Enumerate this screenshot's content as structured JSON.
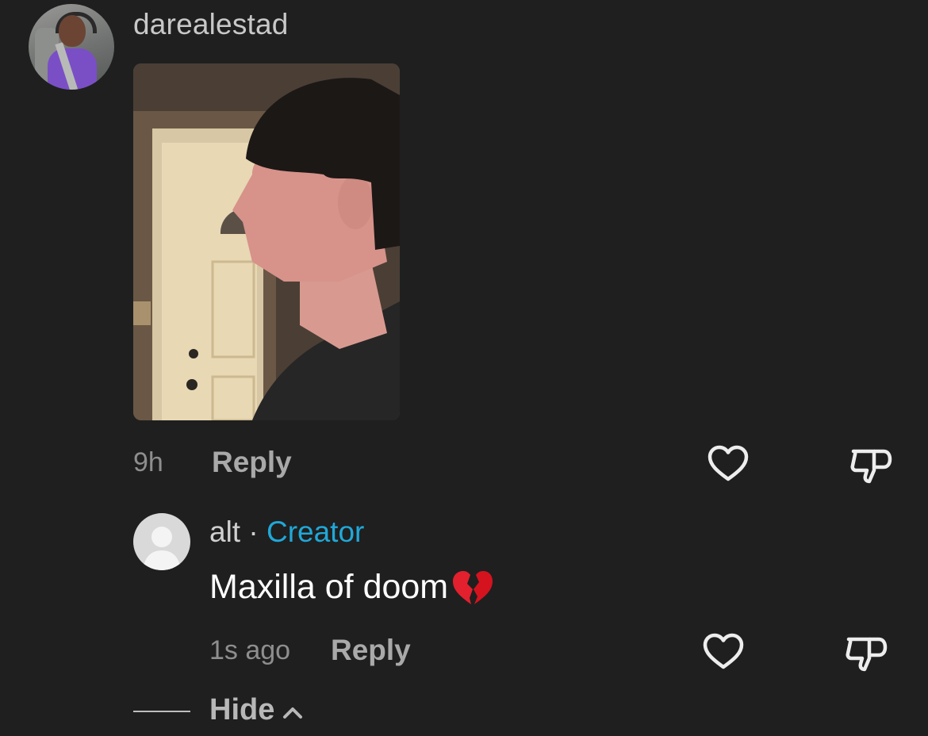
{
  "comment": {
    "username": "darealestad",
    "time": "9h",
    "reply_label": "Reply"
  },
  "reply_comment": {
    "username": "alt",
    "separator": "·",
    "badge": "Creator",
    "text": "Maxilla of doom",
    "emoji": "broken-heart",
    "time": "1s ago",
    "reply_label": "Reply"
  },
  "thread": {
    "hide_label": "Hide"
  },
  "icons": {
    "like": "heart-outline-icon",
    "dislike": "thumbs-down-icon",
    "collapse": "chevron-up-icon"
  },
  "colors": {
    "background": "#1f1f1f",
    "creator_badge": "#20a8d8",
    "muted_text": "#8e8e8e"
  }
}
